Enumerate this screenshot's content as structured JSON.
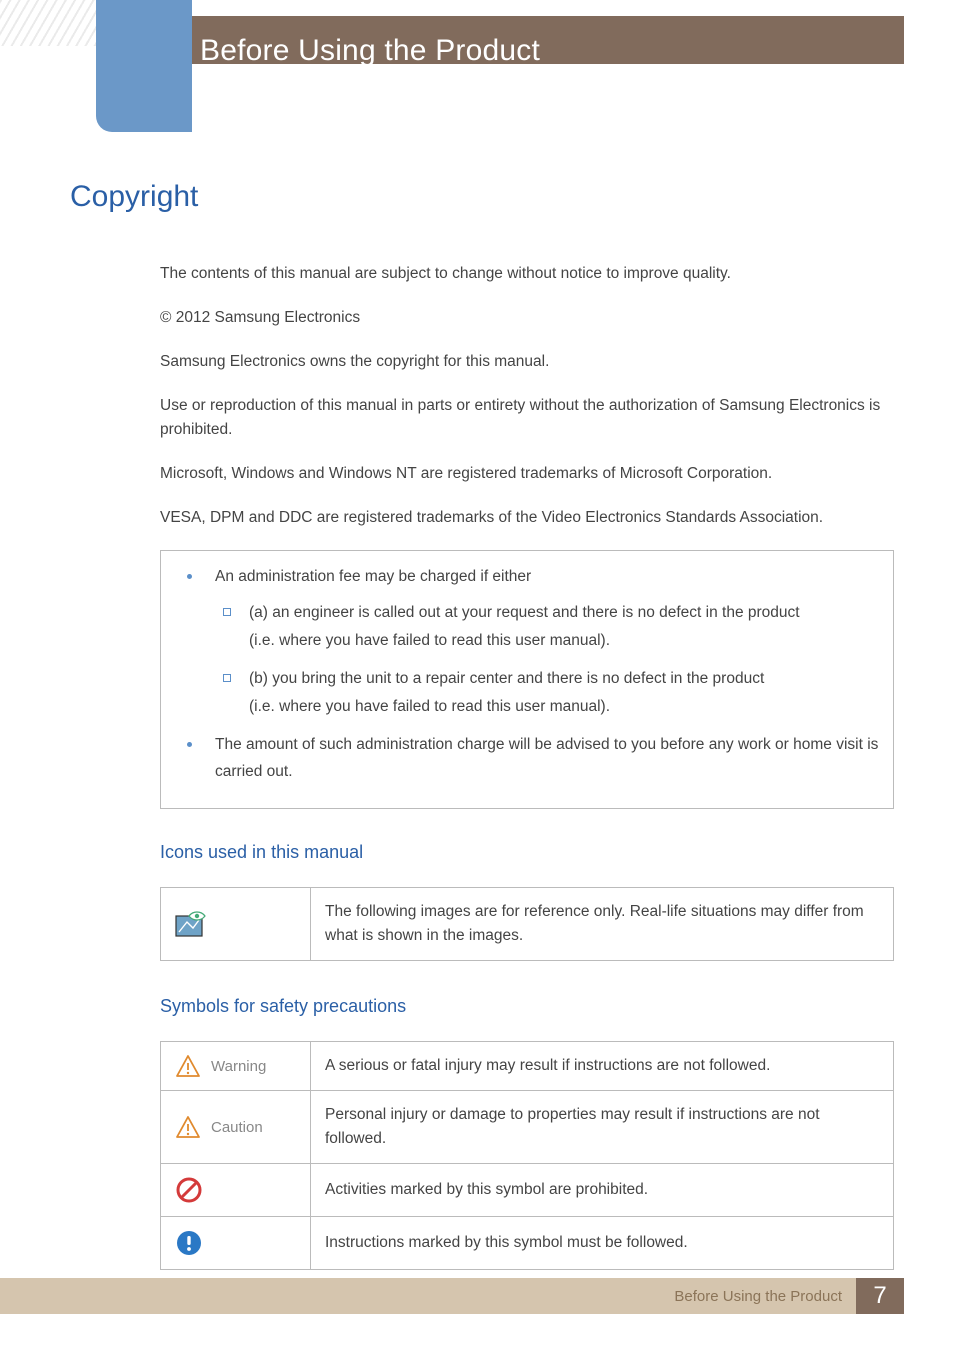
{
  "chapter_title": "Before Using the Product",
  "section_title": "Copyright",
  "paragraphs": [
    "The contents of this manual are subject to change without notice to improve quality.",
    "© 2012 Samsung Electronics",
    "Samsung Electronics owns the copyright for this manual.",
    "Use or reproduction of this manual in parts or entirety without the authorization of Samsung Electronics is prohibited.",
    "Microsoft, Windows and Windows NT are registered trademarks of Microsoft Corporation.",
    "VESA, DPM and DDC are registered trademarks of the Video Electronics Standards Association."
  ],
  "admin_box": {
    "items": [
      {
        "text": "An administration fee may be charged if either",
        "sub": [
          {
            "line1": "(a) an engineer is called out at your request and there is no defect in the product",
            "line2": "(i.e. where you have failed to read this user manual)."
          },
          {
            "line1": "(b) you bring the unit to a repair center and there is no defect in the product",
            "line2": "(i.e. where you have failed to read this user manual)."
          }
        ]
      },
      {
        "text": "The amount of such administration charge will be advised to you before any work or home visit is carried out."
      }
    ]
  },
  "icons_heading": "Icons used in this manual",
  "icons_table": {
    "desc": "The following images are for reference only. Real-life situations may differ from what is shown in the images."
  },
  "symbols_heading": "Symbols for safety precautions",
  "symbols_table": [
    {
      "label": "Warning",
      "desc": "A serious or fatal injury may result if instructions are not followed."
    },
    {
      "label": "Caution",
      "desc": "Personal injury or damage to properties may result if instructions are not followed."
    },
    {
      "label": "",
      "desc": "Activities marked by this symbol are prohibited."
    },
    {
      "label": "",
      "desc": "Instructions marked by this symbol must be followed."
    }
  ],
  "footer": {
    "label": "Before Using the Product",
    "page": "7"
  }
}
